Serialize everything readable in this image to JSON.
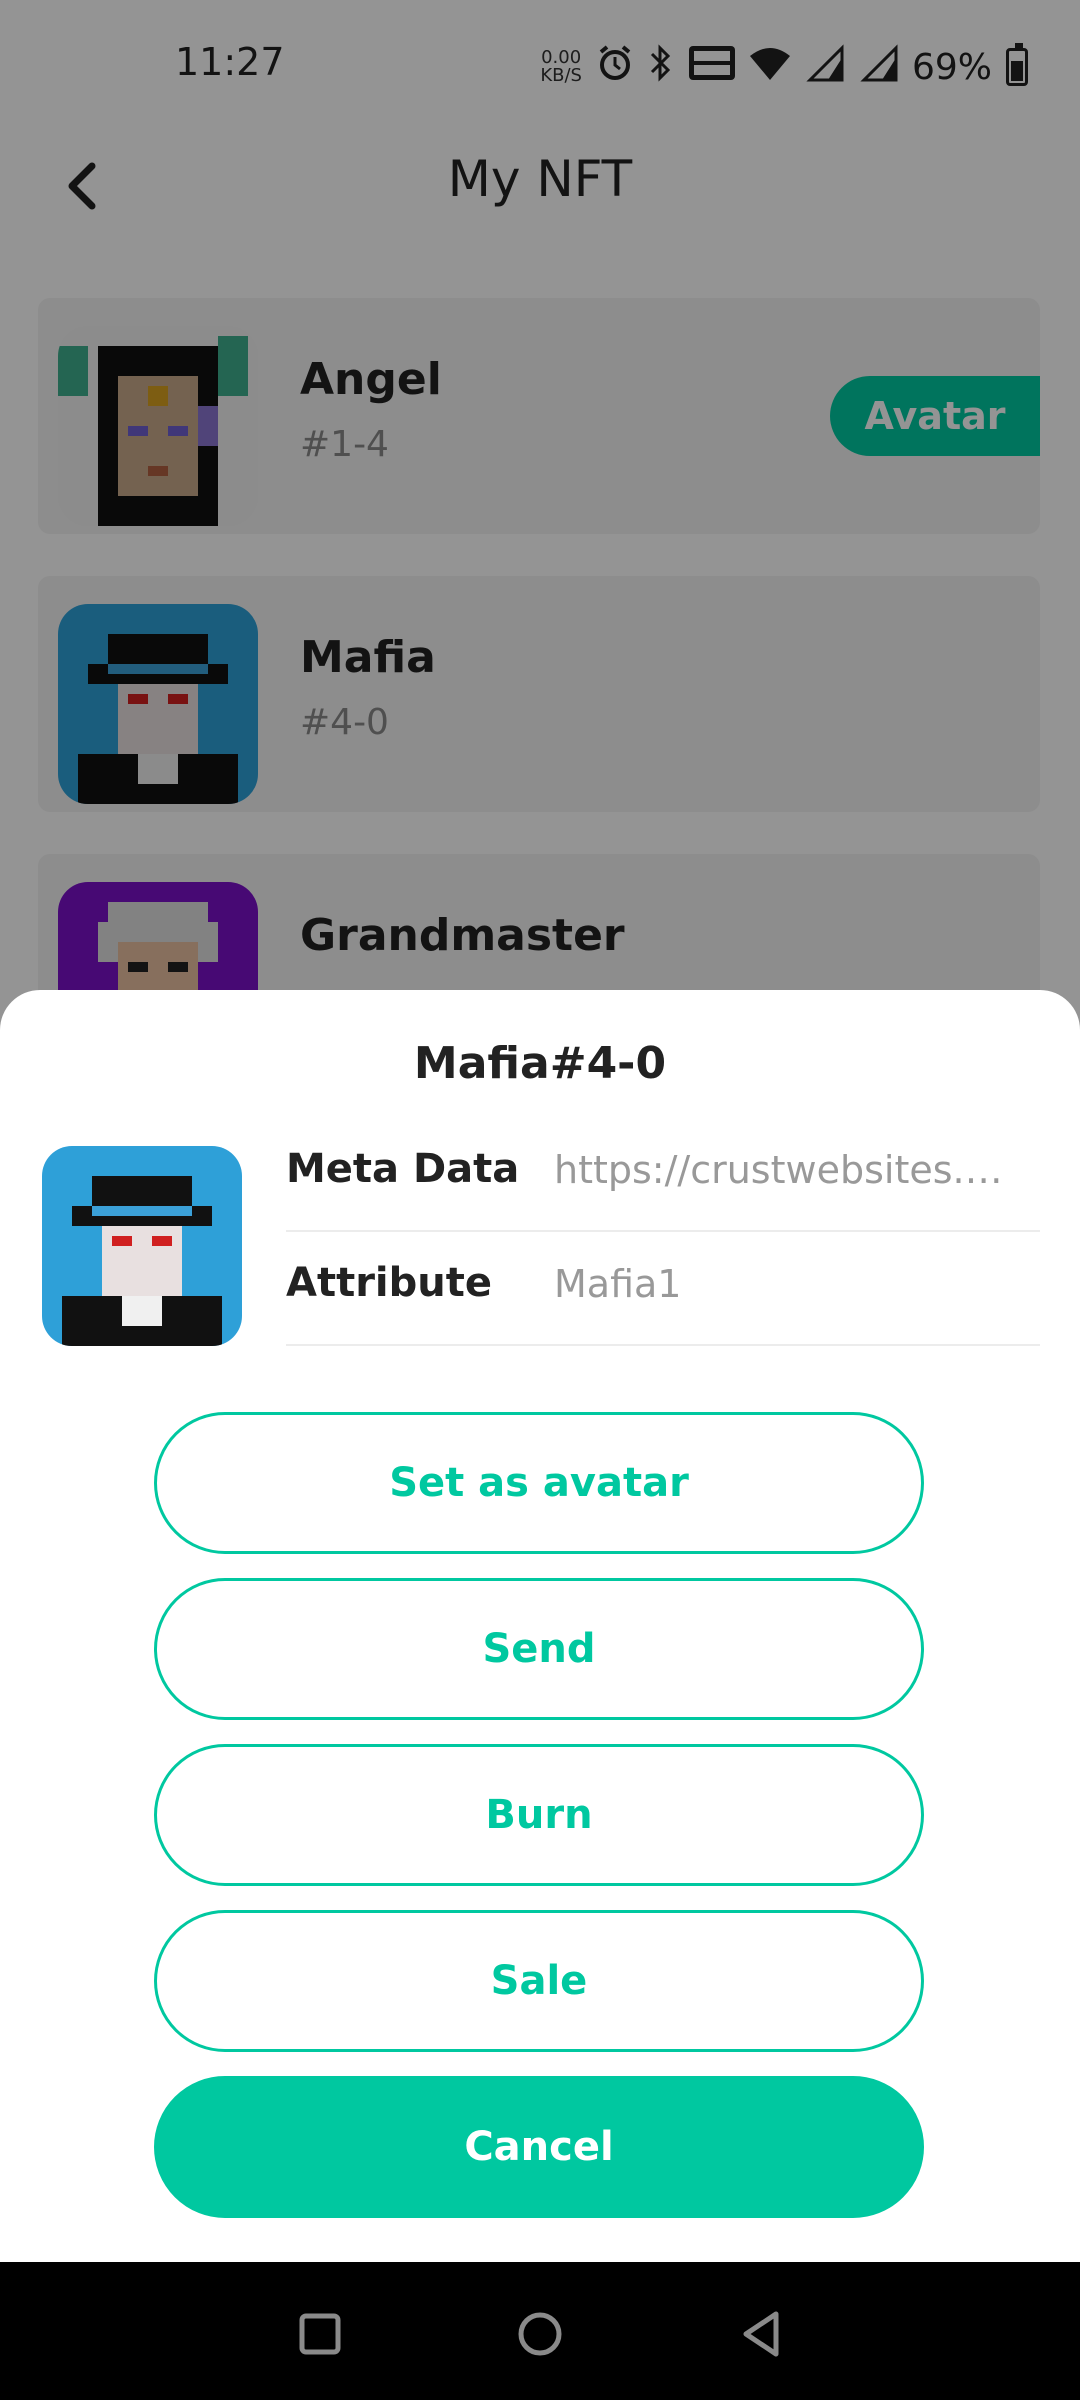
{
  "status_bar": {
    "time": "11:27",
    "net_speed_value": "0.00",
    "net_speed_unit": "KB/S",
    "battery": "69%",
    "icons": [
      "alarm-icon",
      "bluetooth-icon",
      "volte-icon",
      "wifi-icon",
      "signal-4g-icon",
      "signal-4g-icon",
      "battery-icon"
    ]
  },
  "header": {
    "title": "My NFT",
    "back_icon": "back-arrow-icon"
  },
  "nft_list": [
    {
      "name": "Angel",
      "id": "#1-4",
      "tag": "Avatar"
    },
    {
      "name": "Mafia",
      "id": "#4-0"
    },
    {
      "name": "Grandmaster"
    }
  ],
  "sheet": {
    "title": "Mafia#4-0",
    "rows": [
      {
        "label": "Meta Data",
        "value": "https://crustwebsites.n…"
      },
      {
        "label": "Attribute",
        "value": "Mafia1"
      }
    ],
    "buttons": {
      "set_avatar": "Set as avatar",
      "send": "Send",
      "burn": "Burn",
      "sale": "Sale",
      "cancel": "Cancel"
    }
  },
  "colors": {
    "accent": "#00c8a0",
    "overlay": "rgba(0,0,0,0.42)"
  },
  "nav_bar": {
    "icons": [
      "recent-apps-icon",
      "home-icon",
      "back-triangle-icon"
    ]
  }
}
